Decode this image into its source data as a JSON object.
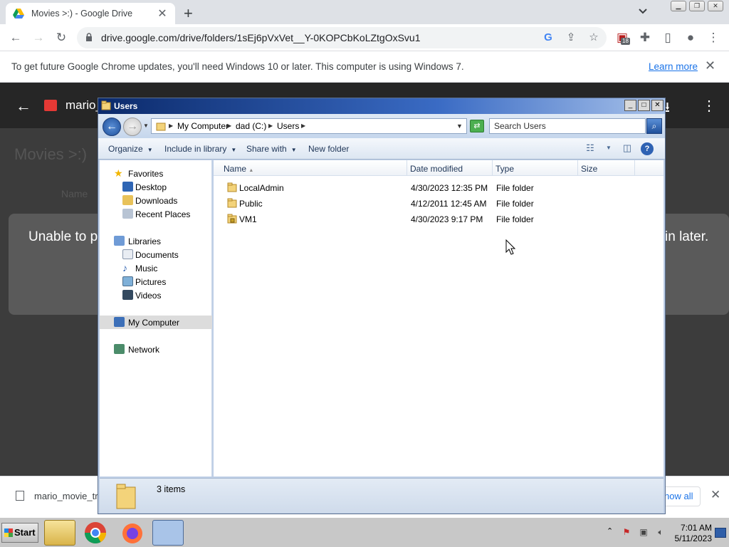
{
  "browser": {
    "tab_title": "Movies >:) - Google Drive",
    "tab_close": "✕",
    "new_tab": "+",
    "url": "drive.google.com/drive/folders/1sEj6pVxVet__Y-0KOPCbKoLZtgOxSvu1",
    "extension_badge": "18"
  },
  "infobar": {
    "text": "To get future Google Chrome updates, you'll need Windows 10 or later. This computer is using Windows 7.",
    "link": "Learn more",
    "close": "✕"
  },
  "drive": {
    "file_name": "mario_",
    "faint_title": "Movies >:)",
    "faint_col": "Name",
    "message_left": "Unable to p",
    "message_right": "in later."
  },
  "explorer": {
    "title": "Users",
    "nav": {
      "back": "←",
      "forward": "→",
      "breadcrumbs": [
        "My Computer",
        "dad (C:)",
        "Users"
      ],
      "search_placeholder": "Search Users"
    },
    "commands": {
      "organize": "Organize",
      "include_in_library": "Include in library",
      "share_with": "Share with",
      "new_folder": "New folder",
      "help": "?"
    },
    "sidebar": {
      "favorites": "Favorites",
      "desktop": "Desktop",
      "downloads": "Downloads",
      "recent_places": "Recent Places",
      "libraries": "Libraries",
      "documents": "Documents",
      "music": "Music",
      "pictures": "Pictures",
      "videos": "Videos",
      "my_computer": "My Computer",
      "network": "Network"
    },
    "columns": {
      "name": "Name",
      "date_modified": "Date modified",
      "type": "Type",
      "size": "Size"
    },
    "rows": [
      {
        "name": "LocalAdmin",
        "date": "4/30/2023 12:35 PM",
        "type": "File folder"
      },
      {
        "name": "Public",
        "date": "4/12/2011 12:45 AM",
        "type": "File folder"
      },
      {
        "name": "VM1",
        "date": "4/30/2023 9:17 PM",
        "type": "File folder"
      }
    ],
    "status": "3 items"
  },
  "shelf": {
    "file": "mario_movie_tr",
    "show_all": "how all",
    "close": "✕"
  },
  "taskbar": {
    "start": "Start",
    "time": "7:01 AM",
    "date": "5/11/2023"
  }
}
